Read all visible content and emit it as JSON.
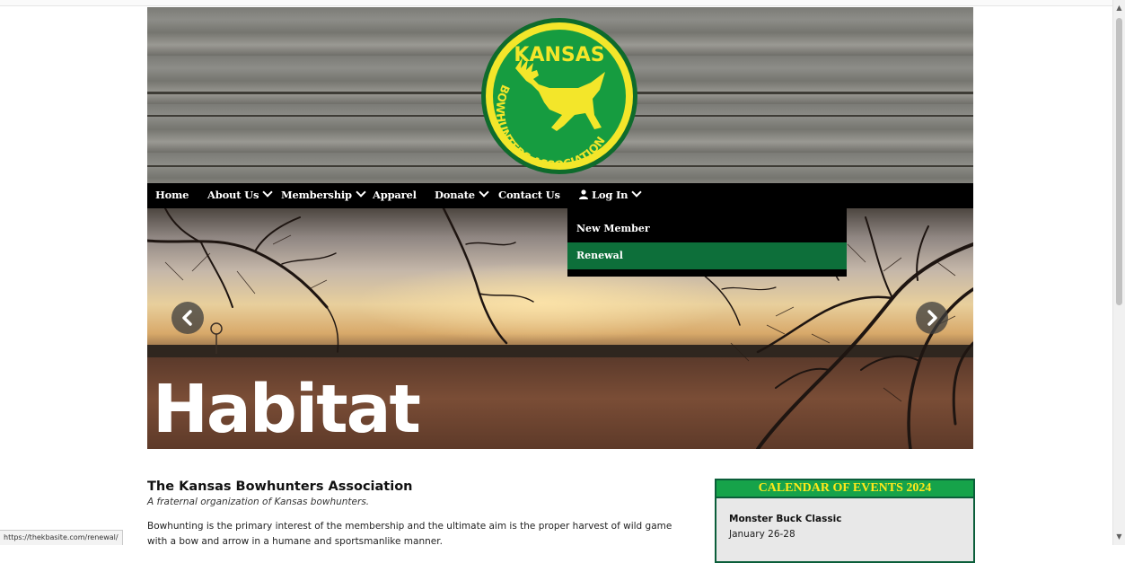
{
  "header": {
    "logo": {
      "alt_text": "Kansas Bowhunters Association",
      "top_text": "KANSAS",
      "ring_text": "BOWHUNTERS ASSOCIATION"
    }
  },
  "nav": {
    "items": [
      {
        "label": "Home",
        "has_dropdown": false
      },
      {
        "label": "About Us",
        "has_dropdown": true
      },
      {
        "label": "Membership",
        "has_dropdown": true
      },
      {
        "label": "Apparel",
        "has_dropdown": false
      },
      {
        "label": "Donate",
        "has_dropdown": true
      },
      {
        "label": "Contact Us",
        "has_dropdown": false
      },
      {
        "label": "Log In",
        "has_dropdown": true,
        "icon": "user-icon"
      }
    ]
  },
  "login_dropdown": {
    "items": [
      {
        "label": "New Member",
        "highlighted": false
      },
      {
        "label": "Renewal",
        "highlighted": true
      }
    ]
  },
  "slider": {
    "slide_title": "Habitat",
    "prev_icon": "chevron-left-icon",
    "next_icon": "chevron-right-icon"
  },
  "main": {
    "title": "The Kansas Bowhunters Association",
    "subtitle": "A fraternal organization of Kansas bowhunters.",
    "intro": "Bowhunting is the primary interest of the membership and the ultimate aim is the proper harvest of wild game with a bow and arrow in a humane and sportsmanlike manner."
  },
  "calendar": {
    "heading": "CALENDAR OF EVENTS 2024",
    "events": [
      {
        "name": "Monster Buck Classic",
        "date": "January 26-28"
      }
    ]
  },
  "statusbar": {
    "url": "https://thekbasite.com/renewal/"
  },
  "colors": {
    "nav_bg": "#000000",
    "accent_green": "#0d6f3a",
    "calendar_header_bg": "#16a34a",
    "calendar_header_text": "#ffe81a",
    "logo_yellow": "#f3e62a",
    "logo_green": "#169c40"
  }
}
